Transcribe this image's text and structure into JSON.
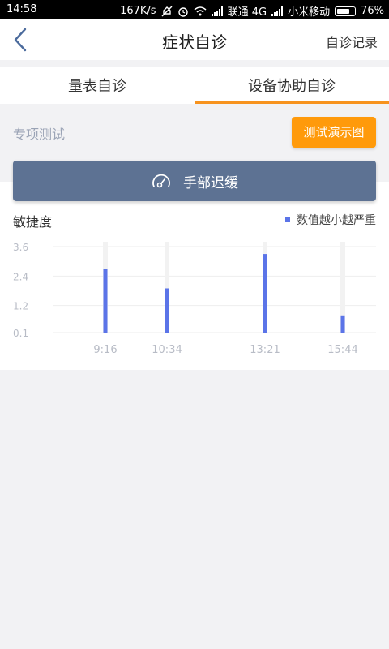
{
  "status_bar": {
    "time": "14:58",
    "speed": "167K/s",
    "carrier1": "联通 4G",
    "carrier2": "小米移动",
    "battery": "76%"
  },
  "nav": {
    "title": "症状自诊",
    "record_label": "自诊记录",
    "icons": {
      "back": "chevron-left-icon"
    }
  },
  "tabs": [
    {
      "label": "量表自诊",
      "active": false
    },
    {
      "label": "设备协助自诊",
      "active": true
    }
  ],
  "section": {
    "label": "专项测试",
    "demo_button": "测试演示图"
  },
  "test_button": {
    "label": "手部迟缓",
    "icon": "gauge-icon"
  },
  "colors": {
    "accent": "#f7931e",
    "demo_button": "#ff9a0b",
    "test_button": "#5d7293",
    "bar": "#5b74e8",
    "track": "#f2f2f2"
  },
  "chart_data": {
    "type": "bar",
    "title": "敏捷度",
    "legend": "数值越小越严重",
    "categories": [
      "9:16",
      "10:34",
      "13:21",
      "15:44"
    ],
    "values": [
      2.7,
      1.9,
      3.3,
      0.8
    ],
    "yticks": [
      "0.1",
      "1.2",
      "2.4",
      "3.6"
    ],
    "ylim": [
      0.1,
      3.6
    ],
    "grid": true
  }
}
